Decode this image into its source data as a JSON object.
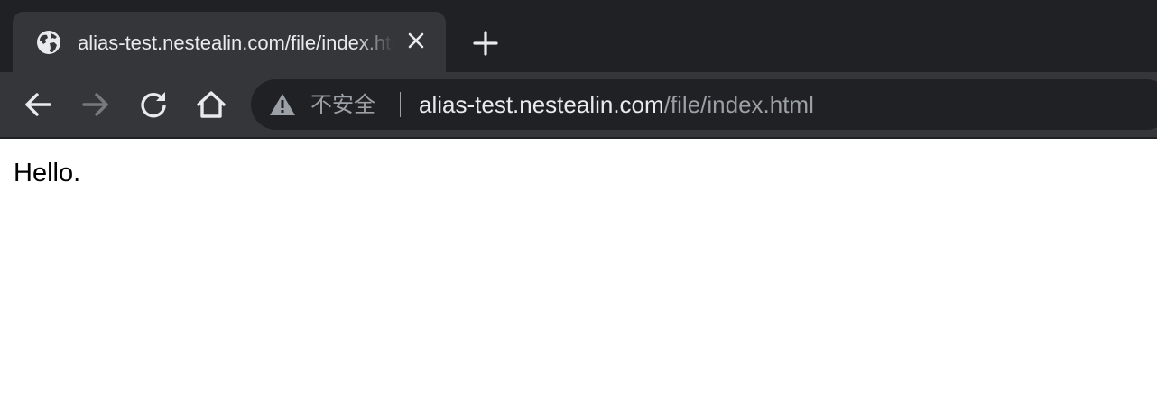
{
  "tab": {
    "title": "alias-test.nestealin.com/file/index.html",
    "favicon": "globe-icon",
    "close_icon": "close-icon"
  },
  "new_tab_icon": "plus-icon",
  "toolbar": {
    "back_icon": "arrow-left-icon",
    "forward_icon": "arrow-right-icon",
    "reload_icon": "reload-icon",
    "home_icon": "home-icon"
  },
  "omnibox": {
    "security_icon": "warning-triangle-icon",
    "security_label": "不安全",
    "url_host": "alias-test.nestealin.com",
    "url_path": "/file/index.html"
  },
  "page": {
    "text": "Hello."
  },
  "colors": {
    "tabstrip": "#202124",
    "toolbar": "#35363a",
    "omnibox": "#202124",
    "text_primary": "#e8eaed",
    "text_secondary": "#9aa0a6"
  }
}
